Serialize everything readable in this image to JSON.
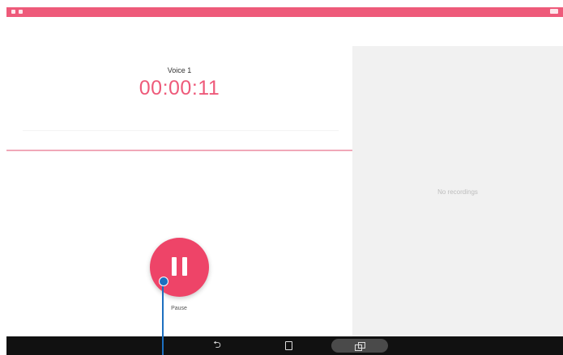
{
  "status_bar": {
    "color": "#ee5a7a",
    "left_icons": [
      "notification-icon",
      "notification-icon"
    ],
    "right_icons": [
      "battery-icon"
    ]
  },
  "recorder": {
    "recording_name": "Voice 1",
    "elapsed_time": "00:00:11",
    "accent_color": "#ee5a7a",
    "pause_button_icon": "pause-icon",
    "pause_label": "Pause"
  },
  "recordings_panel": {
    "empty_text": "No recordings"
  },
  "nav_bar": {
    "back_icon": "back-icon",
    "home_icon": "home-icon",
    "recent_icon": "recent-apps-icon"
  },
  "annotation": {
    "pointer_color": "#1d6fc0"
  }
}
